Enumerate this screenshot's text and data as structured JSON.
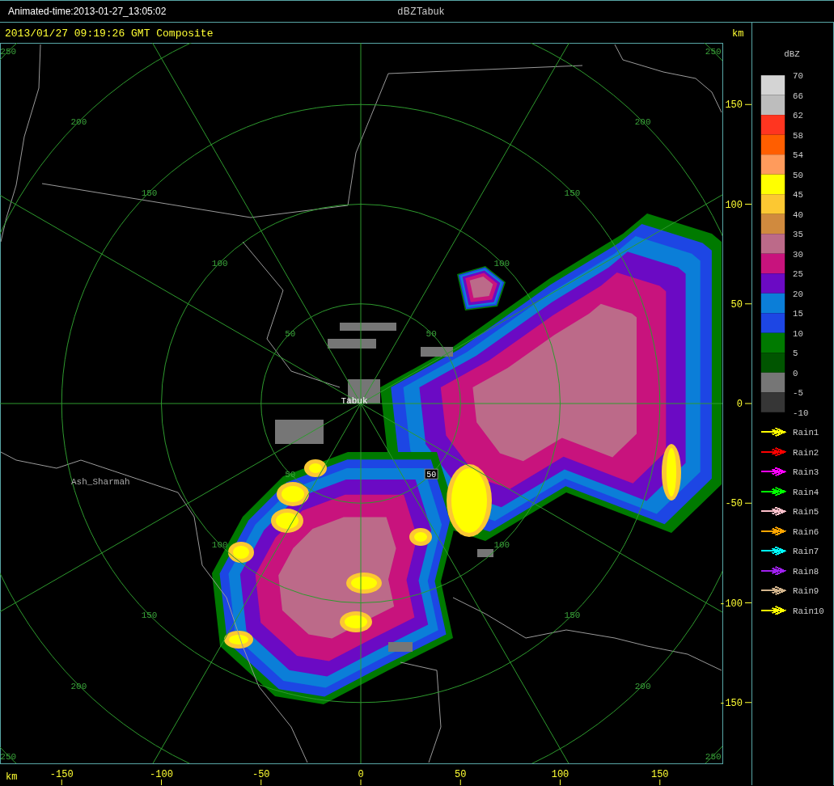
{
  "window": {
    "title": "dBZTabuk"
  },
  "animated_time": "Animated-time:2013-01-27_13:05:02",
  "plot": {
    "title": "2013/01/27 09:19:26 GMT Composite",
    "y_axis": {
      "unit": "km",
      "ticks": [
        "150",
        "100",
        "50",
        "0",
        "-50",
        "-100",
        "-150"
      ]
    },
    "x_axis": {
      "unit": "km",
      "ticks": [
        "-150",
        "-100",
        "-50",
        "0",
        "50",
        "100",
        "150"
      ]
    },
    "range_rings": [
      {
        "labels": [
          "50",
          "50",
          "50",
          "50"
        ],
        "boxed": [
          false,
          false,
          false,
          true
        ]
      },
      {
        "labels": [
          "100",
          "100",
          "100",
          "100"
        ]
      },
      {
        "labels": [
          "150",
          "150",
          "150",
          "150"
        ]
      },
      {
        "labels": [
          "200",
          "200",
          "200",
          "200"
        ]
      },
      {
        "labels": [
          "250",
          "250",
          "250",
          "250"
        ]
      }
    ],
    "places": [
      {
        "kind": "radar",
        "label": "Tabuk"
      },
      {
        "kind": "town",
        "label": "Ash_Sharmah"
      }
    ]
  },
  "legend": {
    "title": "dBZ",
    "scale": [
      {
        "label": "70",
        "color": "#d4d4d4"
      },
      {
        "label": "66",
        "color": "#bdbdbd"
      },
      {
        "label": "62",
        "color": "#ff3520"
      },
      {
        "label": "58",
        "color": "#ff5e00"
      },
      {
        "label": "54",
        "color": "#ff9b5c"
      },
      {
        "label": "50",
        "color": "#ffff00"
      },
      {
        "label": "45",
        "color": "#fcc832"
      },
      {
        "label": "40",
        "color": "#d08a3e"
      },
      {
        "label": "35",
        "color": "#bc6a89"
      },
      {
        "label": "30",
        "color": "#c8137d"
      },
      {
        "label": "25",
        "color": "#6b0ac4"
      },
      {
        "label": "20",
        "color": "#0b7ed8"
      },
      {
        "label": "15",
        "color": "#1d46e4"
      },
      {
        "label": "10",
        "color": "#007a00"
      },
      {
        "label": "5",
        "color": "#005500"
      },
      {
        "label": "0",
        "color": "#767676"
      },
      {
        "label": "-5",
        "color": "#363636"
      }
    ],
    "bottom_label": "-10"
  },
  "tracks": [
    {
      "label": "Rain1",
      "color": "#ffff00"
    },
    {
      "label": "Rain2",
      "color": "#ff0000"
    },
    {
      "label": "Rain3",
      "color": "#ff00ff"
    },
    {
      "label": "Rain4",
      "color": "#00ff00"
    },
    {
      "label": "Rain5",
      "color": "#ffc0cb"
    },
    {
      "label": "Rain6",
      "color": "#ffa500"
    },
    {
      "label": "Rain7",
      "color": "#00ffff"
    },
    {
      "label": "Rain8",
      "color": "#a020f0"
    },
    {
      "label": "Rain9",
      "color": "#d2b48c"
    },
    {
      "label": "Rain10",
      "color": "#ffff00"
    }
  ]
}
